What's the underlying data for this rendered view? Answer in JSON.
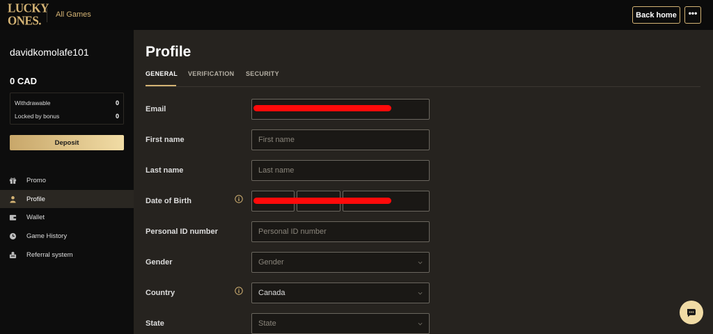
{
  "header": {
    "logo_line1": "LUCKY",
    "logo_line2": "ONES.",
    "all_games": "All Games",
    "back_home": "Back home",
    "more": "•••"
  },
  "sidebar": {
    "username": "davidkomolafe101",
    "balance": "0  CAD",
    "withdrawable_label": "Withdrawable",
    "withdrawable_value": "0",
    "locked_label": "Locked by bonus",
    "locked_value": "0",
    "deposit": "Deposit",
    "nav": [
      {
        "label": "Promo",
        "icon": "gift-icon"
      },
      {
        "label": "Profile",
        "icon": "user-icon"
      },
      {
        "label": "Wallet",
        "icon": "wallet-icon"
      },
      {
        "label": "Game History",
        "icon": "clock-icon"
      },
      {
        "label": "Referral system",
        "icon": "referral-icon"
      }
    ]
  },
  "main": {
    "title": "Profile",
    "tabs": [
      "GENERAL",
      "VERIFICATION",
      "SECURITY"
    ],
    "active_tab": "GENERAL",
    "fields": {
      "email_label": "Email",
      "first_name_label": "First name",
      "first_name_placeholder": "First name",
      "last_name_label": "Last name",
      "last_name_placeholder": "Last name",
      "dob_label": "Date of Birth",
      "personal_id_label": "Personal ID number",
      "personal_id_placeholder": "Personal ID number",
      "gender_label": "Gender",
      "gender_placeholder": "Gender",
      "country_label": "Country",
      "country_value": "Canada",
      "state_label": "State",
      "state_placeholder": "State"
    }
  },
  "colors": {
    "accent": "#d4b374",
    "redaction": "#ff0a0a",
    "background": "#26231f",
    "sidebar": "#0d0d0d"
  }
}
